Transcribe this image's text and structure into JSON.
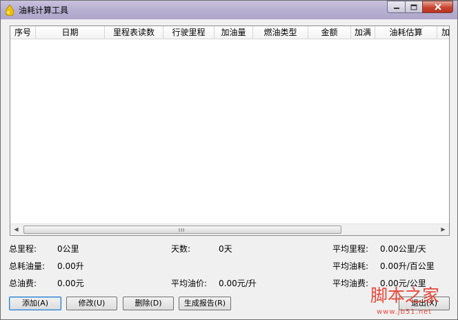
{
  "window": {
    "title": "油耗计算工具"
  },
  "list": {
    "columns": [
      "序号",
      "日期",
      "里程表读数",
      "行驶里程",
      "加油量",
      "燃油类型",
      "金额",
      "加满",
      "油耗估算",
      "加"
    ],
    "scroll_grip": "III"
  },
  "stats": {
    "total_mileage_label": "总里程:",
    "total_mileage_value": "0公里",
    "days_label": "天数:",
    "days_value": "0天",
    "avg_mileage_label": "平均里程:",
    "avg_mileage_value": "0.00公里/天",
    "total_fuel_label": "总耗油量:",
    "total_fuel_value": "0.00升",
    "avg_consumption_label": "平均油耗:",
    "avg_consumption_value": "0.00升/百公里",
    "total_cost_label": "总油费:",
    "total_cost_value": "0.00元",
    "avg_price_label": "平均油价:",
    "avg_price_value": "0.00元/升",
    "avg_cost_label": "平均油费:",
    "avg_cost_value": "0.00元/公里"
  },
  "buttons": {
    "add": "添加(A)",
    "edit": "修改(U)",
    "delete": "删除(D)",
    "report": "生成报告(R)",
    "exit": "退出(X)"
  },
  "watermark": {
    "text": "脚本之家",
    "url": "www.jb51.net"
  }
}
